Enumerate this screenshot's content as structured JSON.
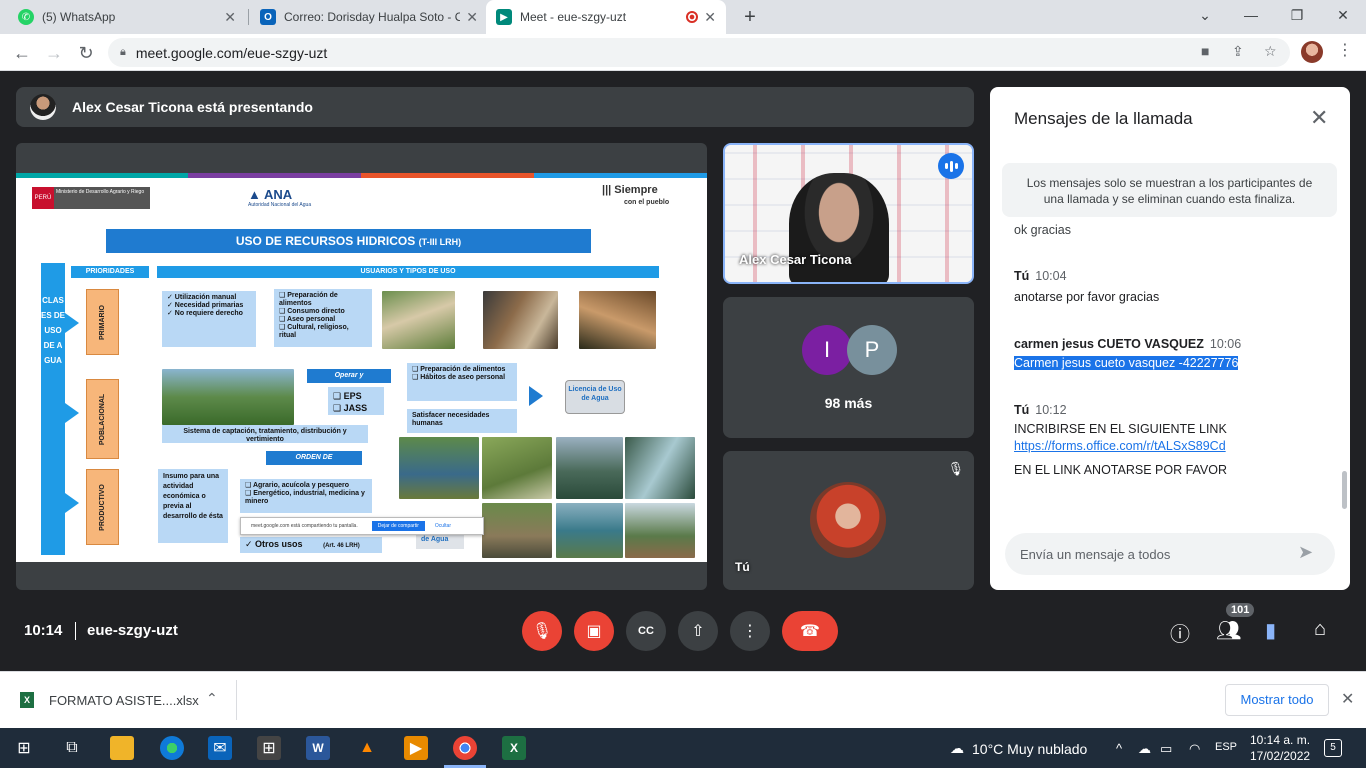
{
  "browser": {
    "tabs": [
      {
        "title": "(5) WhatsApp",
        "favicon": "whatsapp-icon",
        "color": "#25d366"
      },
      {
        "title": "Correo: Dorisday Hualpa Soto - O",
        "favicon": "outlook-icon",
        "color": "#0a64ba"
      },
      {
        "title": "Meet - eue-szgy-uzt",
        "favicon": "meet-icon",
        "color": "#00897b"
      }
    ],
    "url": "meet.google.com/eue-szgy-uzt"
  },
  "meet": {
    "presenter_text": "Alex Cesar Ticona está presentando",
    "slide": {
      "title": "USO DE RECURSOS HIDRICOS",
      "title_small": "(T-III LRH)",
      "prioridades": "PRIORIDADES",
      "usuarios": "USUARIOS Y TIPOS DE USO",
      "clases": "CLASES DE USO DE AGUA",
      "row1": "PRIMARIO",
      "row2": "POBLACIONAL",
      "row3": "PRODUCTIVO",
      "primario_box": "✓ Utilización manual\n✓ Necesidad primarias\n✓ No requiere derecho",
      "primario_uses": "❑ Preparación de alimentos\n❑ Consumo directo\n❑ Aseo personal\n❑ Cultural, religioso, ritual",
      "operar": "Operar y",
      "eps": "❑ EPS",
      "jass": "❑ JASS",
      "pobl_uses": "❑ Preparación de alimentos\n❑ Hábitos de aseo personal",
      "satisfacer": "Satisfacer necesidades humanas",
      "sistema": "Sistema de captación, tratamiento, distribución y vertimiento",
      "licencia": "Licencia de Uso de Agua",
      "orden": "ORDEN DE",
      "insumo": "Insumo para una actividad económica o previa al desarrollo de ésta",
      "prod_uses": "❑ Agrario, acuícola y pesquero\n❑ Energético, industrial, medicina y minero",
      "otros": "✓ Otros usos",
      "art": "(Art. 46 LRH)",
      "de_agua": "de Agua",
      "ministerio": "Ministerio de Desarrollo Agrario y Riego",
      "peru": "PERÚ",
      "ana": "ANA",
      "ana_sub": "Autoridad Nacional del Agua",
      "siempre": "Siempre",
      "siempre_sub": "con el pueblo",
      "toast_text": "meet.google.com está compartiendo tu pantalla.",
      "toast_btn": "Dejar de compartir",
      "toast_hide": "Ocultar"
    },
    "tiles": {
      "alex_name": "Alex Cesar Ticona",
      "p1_initial": "I",
      "p1_color": "#7b1fa2",
      "p2_initial": "P",
      "p2_color": "#78909c",
      "more": "98 más",
      "me": "Tú"
    },
    "time": "10:14",
    "code": "eue-szgy-uzt",
    "participants_count": "101"
  },
  "chat": {
    "title": "Mensajes de la llamada",
    "note": "Los mensajes solo se muestran a los participantes de una llamada y se eliminan cuando esta finaliza.",
    "partial": "ok gracias",
    "messages": [
      {
        "sender": "Tú",
        "time": "10:04",
        "body": "anotarse por favor gracias"
      },
      {
        "sender": "carmen jesus CUETO VASQUEZ",
        "time": "10:06",
        "body": "Carmen jesus cueto vasquez -42227776"
      },
      {
        "sender": "Tú",
        "time": "10:12",
        "body": "INCRIBIRSE EN EL SIGUIENTE LINK",
        "link": "https://forms.office.com/r/tALSxS89Cd",
        "body2": "EN EL LINK ANOTARSE POR FAVOR"
      }
    ],
    "placeholder": "Envía un mensaje a todos"
  },
  "download": {
    "file": "FORMATO ASISTE....xlsx",
    "show_all": "Mostrar todo"
  },
  "taskbar": {
    "weather": "10°C  Muy nublado",
    "lang": "ESP",
    "time": "10:14 a. m.",
    "date": "17/02/2022",
    "notifications": "5"
  }
}
